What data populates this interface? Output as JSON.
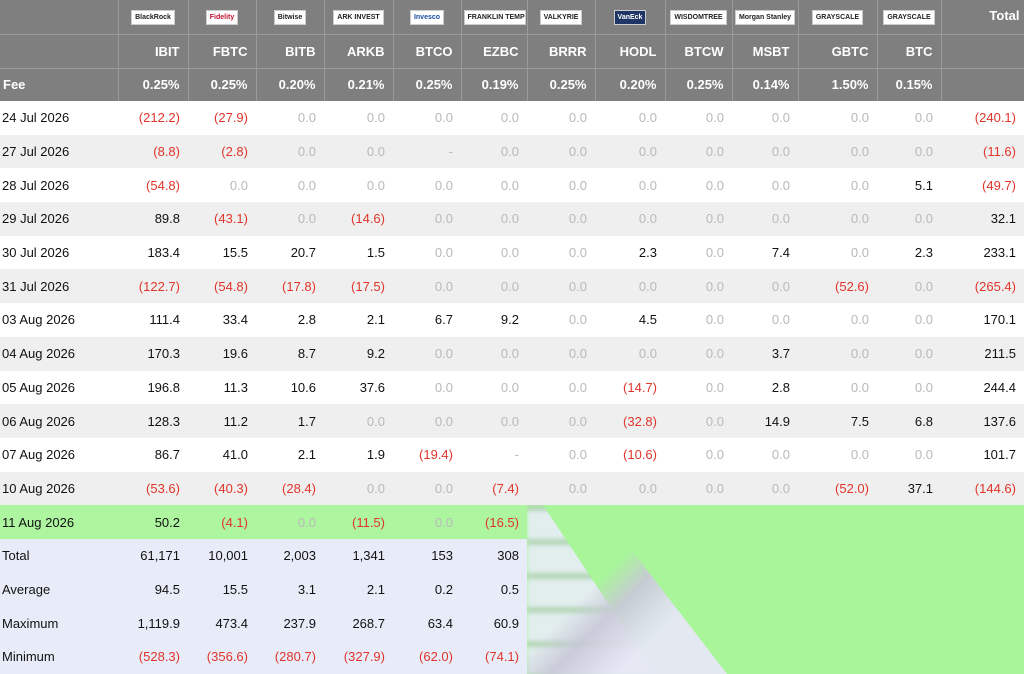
{
  "header": {
    "total_label": "Total",
    "fee_label": "Fee",
    "logos": [
      {
        "text": "BlackRock",
        "style": "dark"
      },
      {
        "text": "Fidelity",
        "style": "red"
      },
      {
        "text": "Bitwise",
        "style": "dark"
      },
      {
        "text": "ARK INVEST",
        "style": "dark"
      },
      {
        "text": "Invesco",
        "style": "blue"
      },
      {
        "text": "FRANKLIN TEMPLETON",
        "style": "dark"
      },
      {
        "text": "VALKYRIE",
        "style": "dark"
      },
      {
        "text": "VanEck",
        "style": "navy"
      },
      {
        "text": "WISDOMTREE",
        "style": "dark"
      },
      {
        "text": "Morgan Stanley",
        "style": "dark"
      },
      {
        "text": "GRAYSCALE",
        "style": "dark"
      },
      {
        "text": "GRAYSCALE",
        "style": "dark"
      }
    ],
    "tickers": [
      "IBIT",
      "FBTC",
      "BITB",
      "ARKB",
      "BTCO",
      "EZBC",
      "BRRR",
      "HODL",
      "BTCW",
      "MSBT",
      "GBTC",
      "BTC"
    ],
    "fees": [
      "0.25%",
      "0.25%",
      "0.20%",
      "0.21%",
      "0.25%",
      "0.19%",
      "0.25%",
      "0.20%",
      "0.25%",
      "0.14%",
      "1.50%",
      "0.15%"
    ]
  },
  "rows": [
    {
      "date": "24 Jul 2026",
      "values": [
        "(212.2)",
        "(27.9)",
        "0.0",
        "0.0",
        "0.0",
        "0.0",
        "0.0",
        "0.0",
        "0.0",
        "0.0",
        "0.0",
        "0.0"
      ],
      "total": "(240.1)"
    },
    {
      "date": "27 Jul 2026",
      "values": [
        "(8.8)",
        "(2.8)",
        "0.0",
        "0.0",
        "-",
        "0.0",
        "0.0",
        "0.0",
        "0.0",
        "0.0",
        "0.0",
        "0.0"
      ],
      "total": "(11.6)"
    },
    {
      "date": "28 Jul 2026",
      "values": [
        "(54.8)",
        "0.0",
        "0.0",
        "0.0",
        "0.0",
        "0.0",
        "0.0",
        "0.0",
        "0.0",
        "0.0",
        "0.0",
        "5.1"
      ],
      "total": "(49.7)"
    },
    {
      "date": "29 Jul 2026",
      "values": [
        "89.8",
        "(43.1)",
        "0.0",
        "(14.6)",
        "0.0",
        "0.0",
        "0.0",
        "0.0",
        "0.0",
        "0.0",
        "0.0",
        "0.0"
      ],
      "total": "32.1"
    },
    {
      "date": "30 Jul 2026",
      "values": [
        "183.4",
        "15.5",
        "20.7",
        "1.5",
        "0.0",
        "0.0",
        "0.0",
        "2.3",
        "0.0",
        "7.4",
        "0.0",
        "2.3"
      ],
      "total": "233.1"
    },
    {
      "date": "31 Jul 2026",
      "values": [
        "(122.7)",
        "(54.8)",
        "(17.8)",
        "(17.5)",
        "0.0",
        "0.0",
        "0.0",
        "0.0",
        "0.0",
        "0.0",
        "(52.6)",
        "0.0"
      ],
      "total": "(265.4)"
    },
    {
      "date": "03 Aug 2026",
      "values": [
        "111.4",
        "33.4",
        "2.8",
        "2.1",
        "6.7",
        "9.2",
        "0.0",
        "4.5",
        "0.0",
        "0.0",
        "0.0",
        "0.0"
      ],
      "total": "170.1"
    },
    {
      "date": "04 Aug 2026",
      "values": [
        "170.3",
        "19.6",
        "8.7",
        "9.2",
        "0.0",
        "0.0",
        "0.0",
        "0.0",
        "0.0",
        "3.7",
        "0.0",
        "0.0"
      ],
      "total": "211.5"
    },
    {
      "date": "05 Aug 2026",
      "values": [
        "196.8",
        "11.3",
        "10.6",
        "37.6",
        "0.0",
        "0.0",
        "0.0",
        "(14.7)",
        "0.0",
        "2.8",
        "0.0",
        "0.0"
      ],
      "total": "244.4"
    },
    {
      "date": "06 Aug 2026",
      "values": [
        "128.3",
        "11.2",
        "1.7",
        "0.0",
        "0.0",
        "0.0",
        "0.0",
        "(32.8)",
        "0.0",
        "14.9",
        "7.5",
        "6.8"
      ],
      "total": "137.6"
    },
    {
      "date": "07 Aug 2026",
      "values": [
        "86.7",
        "41.0",
        "2.1",
        "1.9",
        "(19.4)",
        "-",
        "0.0",
        "(10.6)",
        "0.0",
        "0.0",
        "0.0",
        "0.0"
      ],
      "total": "101.7"
    },
    {
      "date": "10 Aug 2026",
      "values": [
        "(53.6)",
        "(40.3)",
        "(28.4)",
        "0.0",
        "0.0",
        "(7.4)",
        "0.0",
        "0.0",
        "0.0",
        "0.0",
        "(52.0)",
        "37.1"
      ],
      "total": "(144.6)"
    }
  ],
  "today_row": {
    "date": "11 Aug 2026",
    "values": [
      "50.2",
      "(4.1)",
      "0.0",
      "(11.5)",
      "0.0",
      "(16.5)"
    ]
  },
  "summary_rows": [
    {
      "label": "Total",
      "values": [
        "61,171",
        "10,001",
        "2,003",
        "1,341",
        "153",
        "308"
      ]
    },
    {
      "label": "Average",
      "values": [
        "94.5",
        "15.5",
        "3.1",
        "2.1",
        "0.2",
        "0.5"
      ]
    },
    {
      "label": "Maximum",
      "values": [
        "1,119.9",
        "473.4",
        "237.9",
        "268.7",
        "63.4",
        "60.9"
      ]
    },
    {
      "label": "Minimum",
      "values": [
        "(528.3)",
        "(356.6)",
        "(280.7)",
        "(327.9)",
        "(62.0)",
        "(74.1)"
      ]
    }
  ],
  "colors": {
    "header_bg": "#7f7f7f",
    "negative": "#e0352b",
    "zero": "#b9b9b9",
    "today_bg": "#aef5a0",
    "summary_bg": "#e8ecf8",
    "overlay_green": "#a9f59a"
  }
}
